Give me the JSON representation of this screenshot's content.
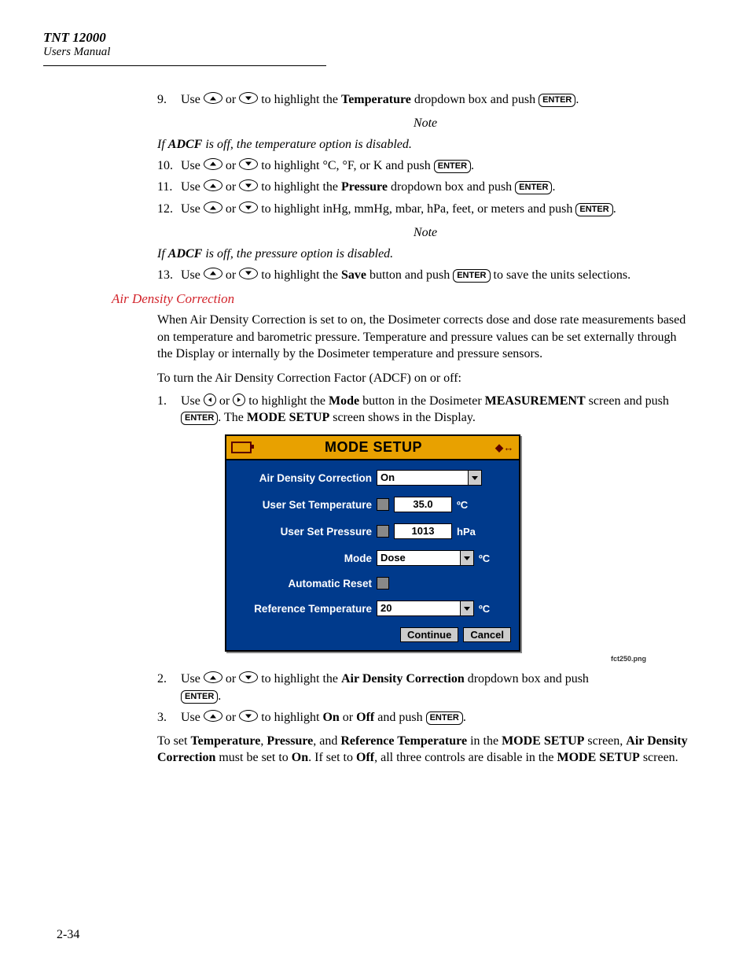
{
  "header": {
    "model": "TNT 12000",
    "sub": "Users Manual"
  },
  "keys": {
    "enter": "ENTER"
  },
  "steps_a": [
    {
      "n": "9.",
      "pre": "Use ",
      "mid1": " or ",
      "mid2": " to highlight the ",
      "bold": "Temperature",
      "post": " dropdown box and push ",
      "tail": "."
    },
    {
      "n": "10.",
      "pre": "Use ",
      "mid1": " or ",
      "mid2": " to highlight °C, °F, or K and push ",
      "tail": "."
    },
    {
      "n": "11.",
      "pre": "Use ",
      "mid1": " or ",
      "mid2": " to highlight the ",
      "bold": "Pressure",
      "post": " dropdown box and push ",
      "tail": "."
    },
    {
      "n": "12.",
      "pre": "Use ",
      "mid1": " or ",
      "mid2": " to highlight inHg, mmHg, mbar, hPa, feet, or meters and push ",
      "tail": "."
    },
    {
      "n": "13.",
      "pre": "Use ",
      "mid1": " or ",
      "mid2": " to highlight the ",
      "bold": "Save",
      "post": " button and push ",
      "tail": " to save the units selections."
    }
  ],
  "note1": {
    "label": "Note",
    "pre": "If ",
    "b": "ADCF",
    "post": " is off, the temperature option is disabled."
  },
  "note2": {
    "label": "Note",
    "pre": "If ",
    "b": "ADCF",
    "post": " is off, the pressure option is disabled."
  },
  "section": {
    "title": "Air Density Correction",
    "para1": "When Air Density Correction is set to on, the Dosimeter corrects dose and dose rate measurements based on temperature and barometric pressure. Temperature and pressure values can be set externally through the Display or internally by the Dosimeter temperature and pressure sensors.",
    "para2": "To turn the Air Density Correction Factor (ADCF) on or off:"
  },
  "steps_b1": {
    "n": "1.",
    "pre": "Use ",
    "mid1": " or ",
    "mid2": " to highlight the ",
    "b1": "Mode",
    "mid3": " button in the Dosimeter ",
    "b2": "MEASUREMENT",
    "mid4": " screen and push ",
    "mid5": ". The ",
    "b3": "MODE SETUP",
    "post": " screen shows in the Display."
  },
  "device": {
    "title": "MODE SETUP",
    "rows": {
      "adc": {
        "label": "Air Density Correction",
        "value": "On"
      },
      "temp": {
        "label": "User Set Temperature",
        "value": "35.0",
        "unit": "ºC"
      },
      "press": {
        "label": "User Set Pressure",
        "value": "1013",
        "unit": "hPa"
      },
      "mode": {
        "label": "Mode",
        "value": "Dose",
        "unit": "ºC"
      },
      "areset": {
        "label": "Automatic Reset"
      },
      "reft": {
        "label": "Reference Temperature",
        "value": "20",
        "unit": "ºC"
      }
    },
    "buttons": {
      "continue": "Continue",
      "cancel": "Cancel"
    }
  },
  "figcap": "fct250.png",
  "steps_b2": {
    "n": "2.",
    "pre": "Use ",
    "mid1": " or ",
    "mid2": " to highlight the ",
    "b1": "Air Density Correction",
    "post": " dropdown box and push ",
    "tail": "."
  },
  "steps_b3": {
    "n": "3.",
    "pre": "Use ",
    "mid1": " or ",
    "mid2": " to highlight ",
    "b1": "On",
    "mid3": " or ",
    "b2": "Off",
    "post": " and push ",
    "tail": "."
  },
  "para_final": {
    "t1": "To set ",
    "b1": "Temperature",
    "t2": ", ",
    "b2": "Pressure",
    "t3": ", and ",
    "b3": "Reference Temperature",
    "t4": " in the ",
    "b4": "MODE SETUP",
    "t5": " screen, ",
    "b5": "Air Density Correction",
    "t6": " must be set to ",
    "b6": "On",
    "t7": ". If set to ",
    "b7": "Off",
    "t8": ", all three controls are disable in the ",
    "b8": "MODE SETUP",
    "t9": " screen."
  },
  "pagenum": "2-34"
}
